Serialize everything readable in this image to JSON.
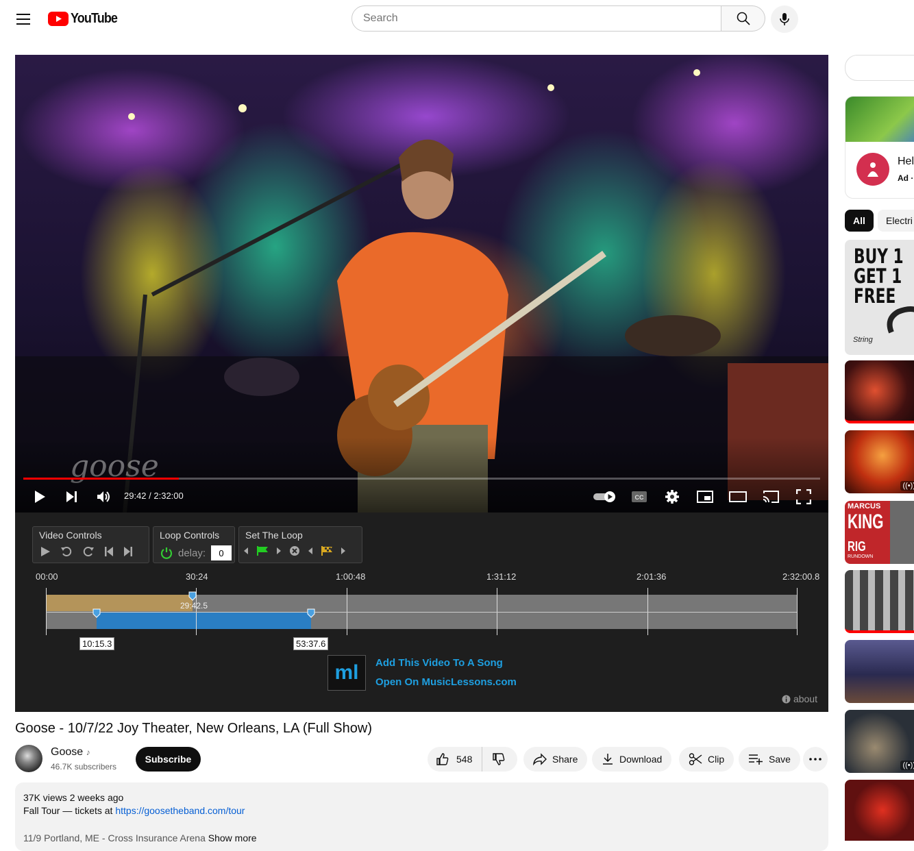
{
  "header": {
    "logo_text": "YouTube",
    "search_placeholder": "Search"
  },
  "player": {
    "time": "29:42 / 2:32:00",
    "progress": 0.195
  },
  "loop_panel": {
    "video_controls_title": "Video Controls",
    "loop_controls_title": "Loop Controls",
    "delay_label": "delay:",
    "delay_value": "0",
    "set_loop_title": "Set The Loop",
    "ticks": [
      "00:00",
      "30:24",
      "1:00:48",
      "1:31:12",
      "2:01:36",
      "2:32:00.8"
    ],
    "current_marker": "29:42.5",
    "loop_start": "10:15.3",
    "loop_end": "53:37.6",
    "ml_logo": "ml",
    "add_link": "Add This Video To A Song",
    "open_link": "Open On MusicLessons.com",
    "about": "about"
  },
  "video": {
    "title": "Goose - 10/7/22 Joy Theater, New Orleans, LA (Full Show)",
    "channel": "Goose",
    "channel_badge": "♪",
    "subscribers": "46.7K subscribers",
    "subscribe": "Subscribe",
    "likes": "548",
    "share": "Share",
    "download": "Download",
    "clip": "Clip",
    "save": "Save"
  },
  "description": {
    "stats": "37K views  2 weeks ago",
    "line1_prefix": "Fall Tour — tickets at ",
    "line1_link": "https://goosetheband.com/tour",
    "line2": "11/9 Portland, ME - Cross Insurance Arena",
    "show_more": "Show more"
  },
  "sidebar": {
    "ad_title": "Hel",
    "ad_label": "Ad ·",
    "chips": [
      "All",
      "Electri"
    ],
    "thumb1_text": [
      "BUY 1",
      "GET 1",
      "FREE"
    ],
    "thumb1_brand": "String",
    "thumb3_text": [
      "MARCUS",
      "KING",
      "RIG",
      "RUNDOWN"
    ],
    "live_icon": "((•))"
  },
  "colors": {
    "youtube_red": "#ff0000",
    "loop_gold": "#b4945a",
    "loop_blue": "#2a7ec3",
    "link_blue": "#1e9fe0"
  }
}
